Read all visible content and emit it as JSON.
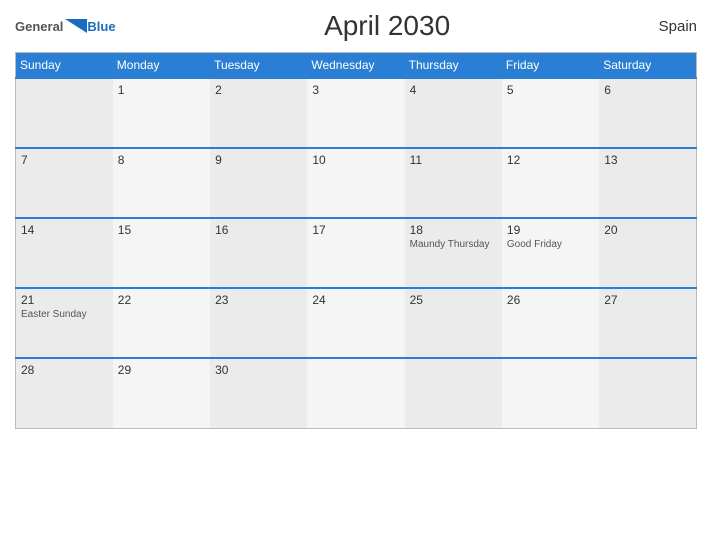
{
  "header": {
    "title": "April 2030",
    "country": "Spain",
    "logo_general": "General",
    "logo_blue": "Blue"
  },
  "days_of_week": [
    "Sunday",
    "Monday",
    "Tuesday",
    "Wednesday",
    "Thursday",
    "Friday",
    "Saturday"
  ],
  "weeks": [
    [
      {
        "num": "",
        "event": ""
      },
      {
        "num": "1",
        "event": ""
      },
      {
        "num": "2",
        "event": ""
      },
      {
        "num": "3",
        "event": ""
      },
      {
        "num": "4",
        "event": ""
      },
      {
        "num": "5",
        "event": ""
      },
      {
        "num": "6",
        "event": ""
      }
    ],
    [
      {
        "num": "7",
        "event": ""
      },
      {
        "num": "8",
        "event": ""
      },
      {
        "num": "9",
        "event": ""
      },
      {
        "num": "10",
        "event": ""
      },
      {
        "num": "11",
        "event": ""
      },
      {
        "num": "12",
        "event": ""
      },
      {
        "num": "13",
        "event": ""
      }
    ],
    [
      {
        "num": "14",
        "event": ""
      },
      {
        "num": "15",
        "event": ""
      },
      {
        "num": "16",
        "event": ""
      },
      {
        "num": "17",
        "event": ""
      },
      {
        "num": "18",
        "event": "Maundy Thursday"
      },
      {
        "num": "19",
        "event": "Good Friday"
      },
      {
        "num": "20",
        "event": ""
      }
    ],
    [
      {
        "num": "21",
        "event": "Easter Sunday"
      },
      {
        "num": "22",
        "event": ""
      },
      {
        "num": "23",
        "event": ""
      },
      {
        "num": "24",
        "event": ""
      },
      {
        "num": "25",
        "event": ""
      },
      {
        "num": "26",
        "event": ""
      },
      {
        "num": "27",
        "event": ""
      }
    ],
    [
      {
        "num": "28",
        "event": ""
      },
      {
        "num": "29",
        "event": ""
      },
      {
        "num": "30",
        "event": ""
      },
      {
        "num": "",
        "event": ""
      },
      {
        "num": "",
        "event": ""
      },
      {
        "num": "",
        "event": ""
      },
      {
        "num": "",
        "event": ""
      }
    ]
  ]
}
